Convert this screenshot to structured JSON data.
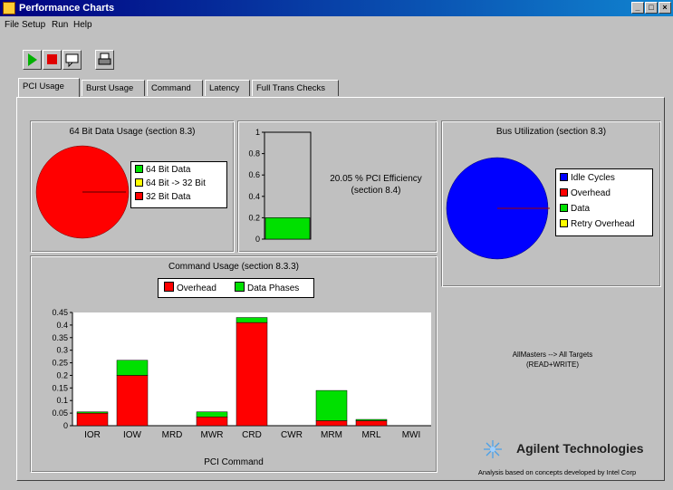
{
  "window": {
    "title": "Performance Charts",
    "controls": [
      "_",
      "□",
      "×"
    ]
  },
  "menu": [
    "File",
    "Setup",
    "Run",
    "Help"
  ],
  "toolbar": {
    "icons": [
      "play-icon",
      "stop-icon",
      "comment-icon",
      "print-icon"
    ]
  },
  "tabs": [
    "PCI Usage",
    "Burst Usage",
    "Command",
    "Latency",
    "Full Trans Checks"
  ],
  "colors": {
    "red": "#ff0000",
    "green": "#00e000",
    "yellow": "#ffff00",
    "blue": "#0000ff"
  },
  "panel_64bit": {
    "title": "64 Bit Data Usage (section 8.3)",
    "legend": [
      "64 Bit Data",
      "64 Bit -> 32 Bit",
      "32 Bit Data"
    ]
  },
  "panel_efficiency": {
    "y_ticks": [
      "1",
      "0.8",
      "0.6",
      "0.4",
      "0.2",
      "0"
    ],
    "label": "20.05 % PCI Efficiency",
    "sublabel": "(section 8.4)"
  },
  "panel_bus": {
    "title": "Bus Utilization (section 8.3)",
    "legend": [
      "Idle Cycles",
      "Overhead",
      "Data",
      "Retry Overhead"
    ]
  },
  "panel_command": {
    "title": "Command Usage (section 8.3.3)",
    "legend": [
      "Overhead",
      "Data Phases"
    ],
    "y_ticks": [
      "0.45",
      "0.4",
      "0.35",
      "0.3",
      "0.25",
      "0.2",
      "0.15",
      "0.1",
      "0.05",
      "0"
    ],
    "xlabel": "PCI Command"
  },
  "info": {
    "line1": "AllMasters --> All Targets",
    "line2": "(READ+WRITE)"
  },
  "brand": {
    "name": "Agilent Technologies",
    "footnote": "Analysis based on concepts developed by Intel Corp"
  },
  "chart_data": [
    {
      "type": "pie",
      "title": "64 Bit Data Usage (section 8.3)",
      "labels": [
        "64 Bit Data",
        "64 Bit -> 32 Bit",
        "32 Bit Data"
      ],
      "values": [
        0,
        0,
        1
      ],
      "colors": [
        "#00e000",
        "#ffff00",
        "#ff0000"
      ],
      "legend_placement": "right"
    },
    {
      "type": "bar",
      "categories": [
        ""
      ],
      "values": [
        0.2005
      ],
      "ylim": [
        0,
        1
      ],
      "y_ticks": [
        1,
        0.8,
        0.6,
        0.4,
        0.2,
        0
      ],
      "annotation": "20.05 % PCI Efficiency (section 8.4)",
      "color": "#00e000"
    },
    {
      "type": "pie",
      "title": "Bus Utilization (section 8.3)",
      "labels": [
        "Idle Cycles",
        "Overhead",
        "Data",
        "Retry Overhead"
      ],
      "values": [
        1,
        0,
        0,
        0
      ],
      "colors": [
        "#0000ff",
        "#ff0000",
        "#00e000",
        "#ffff00"
      ],
      "legend_placement": "right"
    },
    {
      "type": "bar",
      "stacked": true,
      "title": "Command Usage (section 8.3.3)",
      "xlabel": "PCI Command",
      "ylabel": "",
      "categories": [
        "IOR",
        "IOW",
        "MRD",
        "MWR",
        "CRD",
        "CWR",
        "MRM",
        "MRL",
        "MWI"
      ],
      "series": [
        {
          "name": "Overhead",
          "color": "#ff0000",
          "values": [
            0.05,
            0.2,
            0,
            0.035,
            0.41,
            0,
            0.02,
            0.02,
            0
          ]
        },
        {
          "name": "Data Phases",
          "color": "#00e000",
          "values": [
            0.005,
            0.06,
            0,
            0.02,
            0.02,
            0,
            0.12,
            0.005,
            0
          ]
        }
      ],
      "ylim": [
        0,
        0.45
      ],
      "y_ticks": [
        0.45,
        0.4,
        0.35,
        0.3,
        0.25,
        0.2,
        0.15,
        0.1,
        0.05,
        0
      ],
      "grid": false,
      "legend_placement": "top"
    }
  ]
}
